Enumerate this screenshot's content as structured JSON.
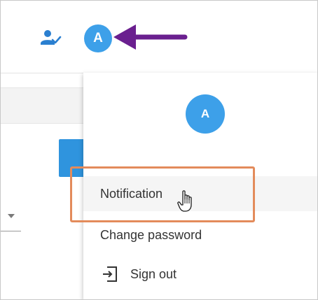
{
  "header": {
    "avatar_initial": "A",
    "user_status_icon": "person-check-icon"
  },
  "annotation": {
    "arrow_color": "#6a1f8f",
    "highlight_color": "#e38b5b"
  },
  "profile_menu": {
    "avatar_initial": "A",
    "avatar_color": "#3da0e9",
    "items": [
      {
        "label": "Notification",
        "icon": null,
        "hovered": true
      },
      {
        "label": "Change password",
        "icon": null,
        "hovered": false
      },
      {
        "label": "Sign out",
        "icon": "sign-out-icon",
        "hovered": false
      }
    ]
  },
  "cursor": {
    "type": "hand-pointer-icon"
  }
}
